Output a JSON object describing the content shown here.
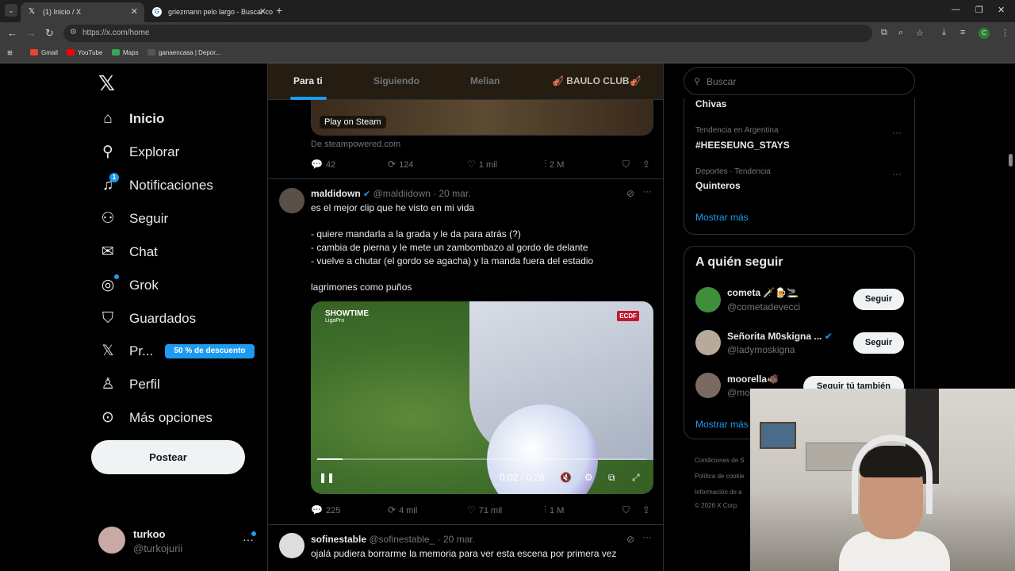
{
  "browser": {
    "active_tab_title": "(1) Inicio / X",
    "other_tab_title": "griezmann pelo largo - Buscar co",
    "url": "https://x.com/home",
    "bookmarks": [
      "Gmail",
      "YouTube",
      "Maps",
      "ganaencasa | Depor..."
    ],
    "profile_initial": "C"
  },
  "nav": {
    "items": [
      {
        "label": "Inicio",
        "icon": "home-icon"
      },
      {
        "label": "Explorar",
        "icon": "search-icon"
      },
      {
        "label": "Notificaciones",
        "icon": "bell-icon",
        "badge": "1"
      },
      {
        "label": "Seguir",
        "icon": "follow-icon"
      },
      {
        "label": "Chat",
        "icon": "mail-icon"
      },
      {
        "label": "Grok",
        "icon": "grok-icon"
      },
      {
        "label": "Guardados",
        "icon": "bookmark-icon"
      },
      {
        "label": "Pr...",
        "icon": "x-icon"
      },
      {
        "label": "Perfil",
        "icon": "person-icon"
      },
      {
        "label": "Más opciones",
        "icon": "more-circle-icon"
      }
    ],
    "promo_label": "50 % de descuento",
    "post_button": "Postear",
    "account": {
      "name": "turkoo",
      "handle": "@turkojurii"
    }
  },
  "feed": {
    "tabs": [
      "Para ti",
      "Siguiendo",
      "Melian",
      "🎻 BAULO CLUB🎻"
    ],
    "card": {
      "label": "Play on Steam",
      "source": "De steampowered.com"
    },
    "prev_actions": {
      "replies": "42",
      "reposts": "124",
      "likes": "1 mil",
      "views": "2 M"
    },
    "tweet1": {
      "name": "maldidown",
      "handle": "@maldiidown",
      "date": "· 20 mar.",
      "lines": [
        "es el mejor clip que he visto en mi vida",
        "",
        "- quiere mandarla a la grada y le da para atrás (?)",
        "- cambia de pierna y le mete un zambombazo al gordo de delante",
        "- vuelve a chutar (el gordo se agacha) y la manda fuera del estadio",
        "",
        "lagrimones como puños"
      ],
      "video": {
        "overlay_left": "SHOWTIME",
        "overlay_left_sub": "LigaPro",
        "overlay_right": "ECDF",
        "time": "0:02 / 0:26",
        "progress": 0.077
      },
      "actions": {
        "replies": "225",
        "reposts": "4 mil",
        "likes": "71 mil",
        "views": "1 M"
      }
    },
    "tweet2": {
      "name": "sofinestable",
      "handle": "@sofinestable_",
      "date": "· 20 mar.",
      "text": "ojalá pudiera borrarme la memoria para ver esta escena por primera vez"
    }
  },
  "sidebar": {
    "search_placeholder": "Buscar",
    "trends": [
      {
        "context": "",
        "name": "Chivas"
      },
      {
        "context": "Tendencia en Argentina",
        "name": "#HEESEUNG_STAYS"
      },
      {
        "context": "Deportes · Tendencia",
        "name": "Quinteros"
      }
    ],
    "show_more": "Mostrar más",
    "who_to_follow": {
      "title": "A quién seguir",
      "users": [
        {
          "name": "cometa 🗡️🍺🚬",
          "handle": "@cometadevecci",
          "button": "Seguir"
        },
        {
          "name": "Señorita M0skigna ...",
          "handle": "@ladymoskigna",
          "button": "Seguir"
        },
        {
          "name": "moorella🐗",
          "handle": "@mo",
          "button": "Seguir tú también"
        }
      ],
      "show_more": "Mostrar más"
    },
    "footer": [
      "Condiciones de S",
      "Política de cookie",
      "Información de a",
      "© 2026 X Corp."
    ]
  }
}
